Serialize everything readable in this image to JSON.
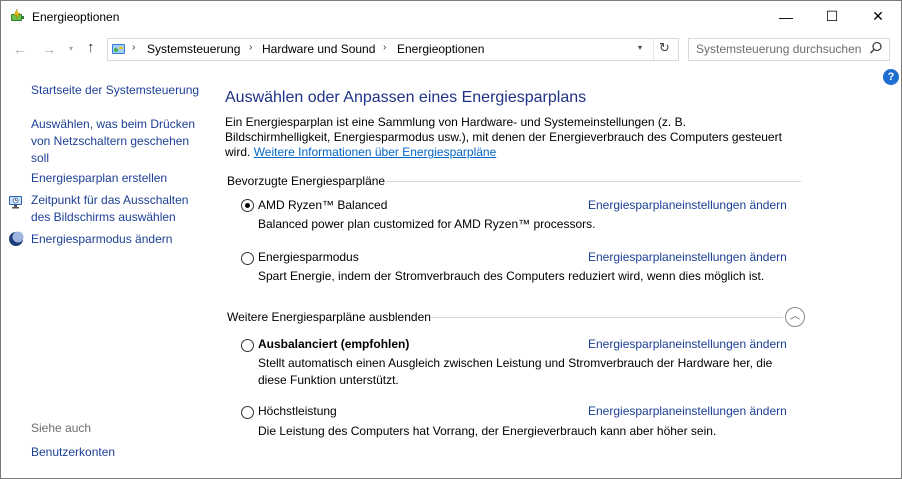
{
  "window": {
    "title": "Energieoptionen",
    "minimize_glyph": "—",
    "maximize_glyph": "☐",
    "close_glyph": "✕"
  },
  "nav": {
    "back_glyph": "←",
    "forward_glyph": "→",
    "recent_glyph": "▾",
    "up_glyph": "↑",
    "breadcrumbs": [
      "Systemsteuerung",
      "Hardware und Sound",
      "Energieoptionen"
    ],
    "separator": "›",
    "dropdown_glyph": "▾",
    "refresh_glyph": "↻"
  },
  "search": {
    "placeholder": "Systemsteuerung durchsuchen",
    "icon": "search-icon"
  },
  "sidebar": {
    "home": "Startseite der Systemsteuerung",
    "links": [
      "Auswählen, was beim Drücken von Netzschaltern geschehen soll",
      "Energiesparplan erstellen",
      "Zeitpunkt für das Ausschalten des Bildschirms auswählen",
      "Energiesparmodus ändern"
    ],
    "see_also": "Siehe auch",
    "see_also_links": [
      "Benutzerkonten"
    ]
  },
  "main": {
    "help_glyph": "?",
    "title": "Auswählen oder Anpassen eines Energiesparplans",
    "intro": "Ein Energiesparplan ist eine Sammlung von Hardware- und Systemeinstellungen (z. B. Bildschirmhelligkeit, Energiesparmodus usw.), mit denen der Energieverbrauch des Computers gesteuert wird.",
    "intro_link": "Weitere Informationen über Energiesparpläne",
    "preferred_heading": "Bevorzugte Energiesparpläne",
    "hidden_heading": "Weitere Energiesparpläne ausblenden",
    "collapse_glyph": "︿",
    "change_link": "Energiesparplaneinstellungen ändern",
    "plans": [
      {
        "name": "AMD Ryzen™ Balanced",
        "desc": "Balanced power plan customized for AMD Ryzen™ processors.",
        "checked": true,
        "bold": false
      },
      {
        "name": "Energiesparmodus",
        "desc": "Spart Energie, indem der Stromverbrauch des Computers reduziert wird, wenn dies möglich ist.",
        "checked": false,
        "bold": false
      },
      {
        "name": "Ausbalanciert (empfohlen)",
        "desc": "Stellt automatisch einen Ausgleich zwischen Leistung und Stromverbrauch der Hardware her, die diese Funktion unterstützt.",
        "checked": false,
        "bold": true
      },
      {
        "name": "Höchstleistung",
        "desc": "Die Leistung des Computers hat Vorrang, der Energieverbrauch kann aber höher sein.",
        "checked": false,
        "bold": false
      }
    ]
  }
}
